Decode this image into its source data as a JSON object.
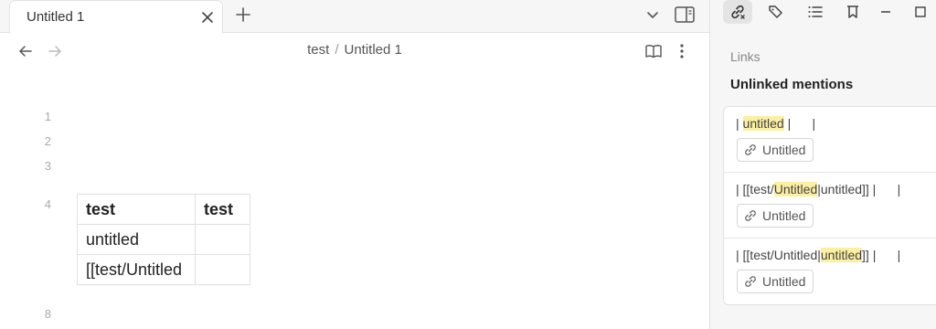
{
  "tab": {
    "title": "Untitled 1"
  },
  "breadcrumb": {
    "folder": "test",
    "separator": "/",
    "file": "Untitled 1"
  },
  "editor": {
    "line_numbers": [
      "1",
      "2",
      "3",
      "4",
      "8"
    ],
    "table": {
      "headers": [
        "test",
        "test"
      ],
      "rows": [
        [
          "untitled",
          ""
        ],
        [
          "[[test/Untitled",
          ""
        ]
      ]
    }
  },
  "sidebar": {
    "links_heading": "Links",
    "unlinked_heading": "Unlinked mentions",
    "mentions": [
      {
        "before": "| ",
        "match": "untitled",
        "after": " |      |",
        "link_label": "Untitled"
      },
      {
        "before": "| [[test/",
        "match": "Untitled",
        "after": "|untitled]] |      |",
        "link_label": "Untitled"
      },
      {
        "before": "| [[test/Untitled|",
        "match": "untitled",
        "after": "]] |      |",
        "link_label": "Untitled"
      }
    ]
  },
  "colors": {
    "highlight": "#fbf0a2",
    "sidebar_bg": "#f6f6f6",
    "tab_bg": "#ffffff"
  },
  "icons": [
    "close-icon",
    "plus-icon",
    "chevron-down-icon",
    "sidebar-toggle-icon",
    "arrow-left-icon",
    "arrow-right-icon",
    "book-open-icon",
    "more-vertical-icon",
    "links-icon",
    "tags-icon",
    "list-icon",
    "bookmark-icon",
    "minimize-icon",
    "maximize-icon",
    "link-icon"
  ]
}
